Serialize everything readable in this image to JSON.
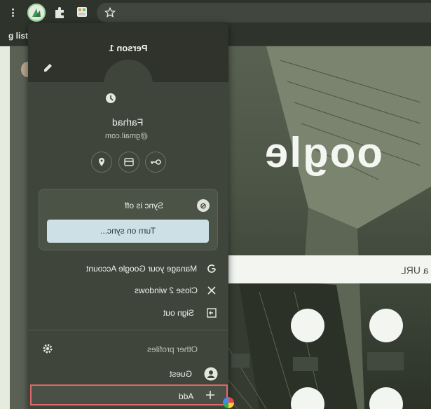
{
  "bookmarks": {
    "partial_label": "g list"
  },
  "page": {
    "logo_text": "oogle",
    "search_placeholder": "a URL"
  },
  "profile_menu": {
    "title": "Person 1",
    "name": "Farhad",
    "email": "@gmail.com",
    "quick_icons": [
      "key-icon",
      "credit-card-icon",
      "location-pin-icon"
    ],
    "sync_status": "Sync is off",
    "turn_on_sync_label": "Turn on sync...",
    "items": [
      {
        "label": "Manage your Google Account",
        "icon": "google-g-icon"
      },
      {
        "label": "Close 2 windows",
        "icon": "close-icon"
      },
      {
        "label": "Sign out",
        "icon": "sign-out-icon"
      }
    ],
    "other_profiles_label": "Other profiles",
    "guest_label": "Guest",
    "add_label": "Add"
  },
  "colors": {
    "highlight": "#e06767",
    "sync_button": "#cde0e6"
  }
}
